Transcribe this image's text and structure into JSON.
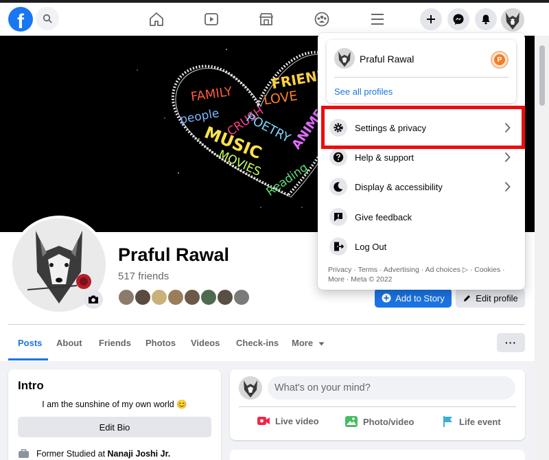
{
  "topbar": {
    "logo_letter": "f",
    "icons": [
      "search-icon",
      "home-icon",
      "watch-icon",
      "marketplace-icon",
      "groups-icon",
      "menu-icon",
      "create-icon",
      "messenger-icon",
      "notifications-icon"
    ]
  },
  "profile": {
    "name": "Praful Rawal",
    "friends": "517 friends",
    "add_story": "Add to Story",
    "edit_profile": "Edit profile",
    "friend_avatar_colors": [
      "#8c7a6b",
      "#5b4a3f",
      "#c9b17a",
      "#9a7d5b",
      "#6b5a4a",
      "#4f6b4f",
      "#5a4f45",
      "#7a7a7a"
    ]
  },
  "tabs": [
    "Posts",
    "About",
    "Friends",
    "Photos",
    "Videos",
    "Check-ins",
    "More"
  ],
  "tabs_more_btn": "···",
  "intro": {
    "title": "Intro",
    "bio": "I am the sunshine of my own world 😊",
    "edit_bio": "Edit Bio",
    "studied_prefix": "Former Studied at ",
    "studied_school": "Nanaji Joshi Jr."
  },
  "composer": {
    "placeholder": "What's on your mind?",
    "live": "Live video",
    "photo": "Photo/video",
    "life": "Life event"
  },
  "cover_words": [
    "FAMILY",
    "CRUSH",
    "LOVE",
    "FRIENDS",
    "people",
    "POETRY",
    "ANIME",
    "MUSIC",
    "MOVIES",
    "Reading"
  ],
  "menu": {
    "profile_name": "Praful Rawal",
    "page_badge": "P",
    "see_all": "See all profiles",
    "items": [
      {
        "label": "Settings & privacy",
        "icon": "gear-icon",
        "chevron": true
      },
      {
        "label": "Help & support",
        "icon": "question-icon",
        "chevron": true
      },
      {
        "label": "Display & accessibility",
        "icon": "moon-icon",
        "chevron": true
      },
      {
        "label": "Give feedback",
        "icon": "feedback-icon",
        "chevron": false
      },
      {
        "label": "Log Out",
        "icon": "logout-icon",
        "chevron": false
      }
    ],
    "footer": "Privacy · Terms · Advertising · Ad choices ▷ · Cookies · More · Meta © 2022"
  },
  "colors": {
    "brand": "#1877f2",
    "accent": "#1b74e4",
    "highlight": "#ee0c0c",
    "background": "#f0f2f5"
  }
}
